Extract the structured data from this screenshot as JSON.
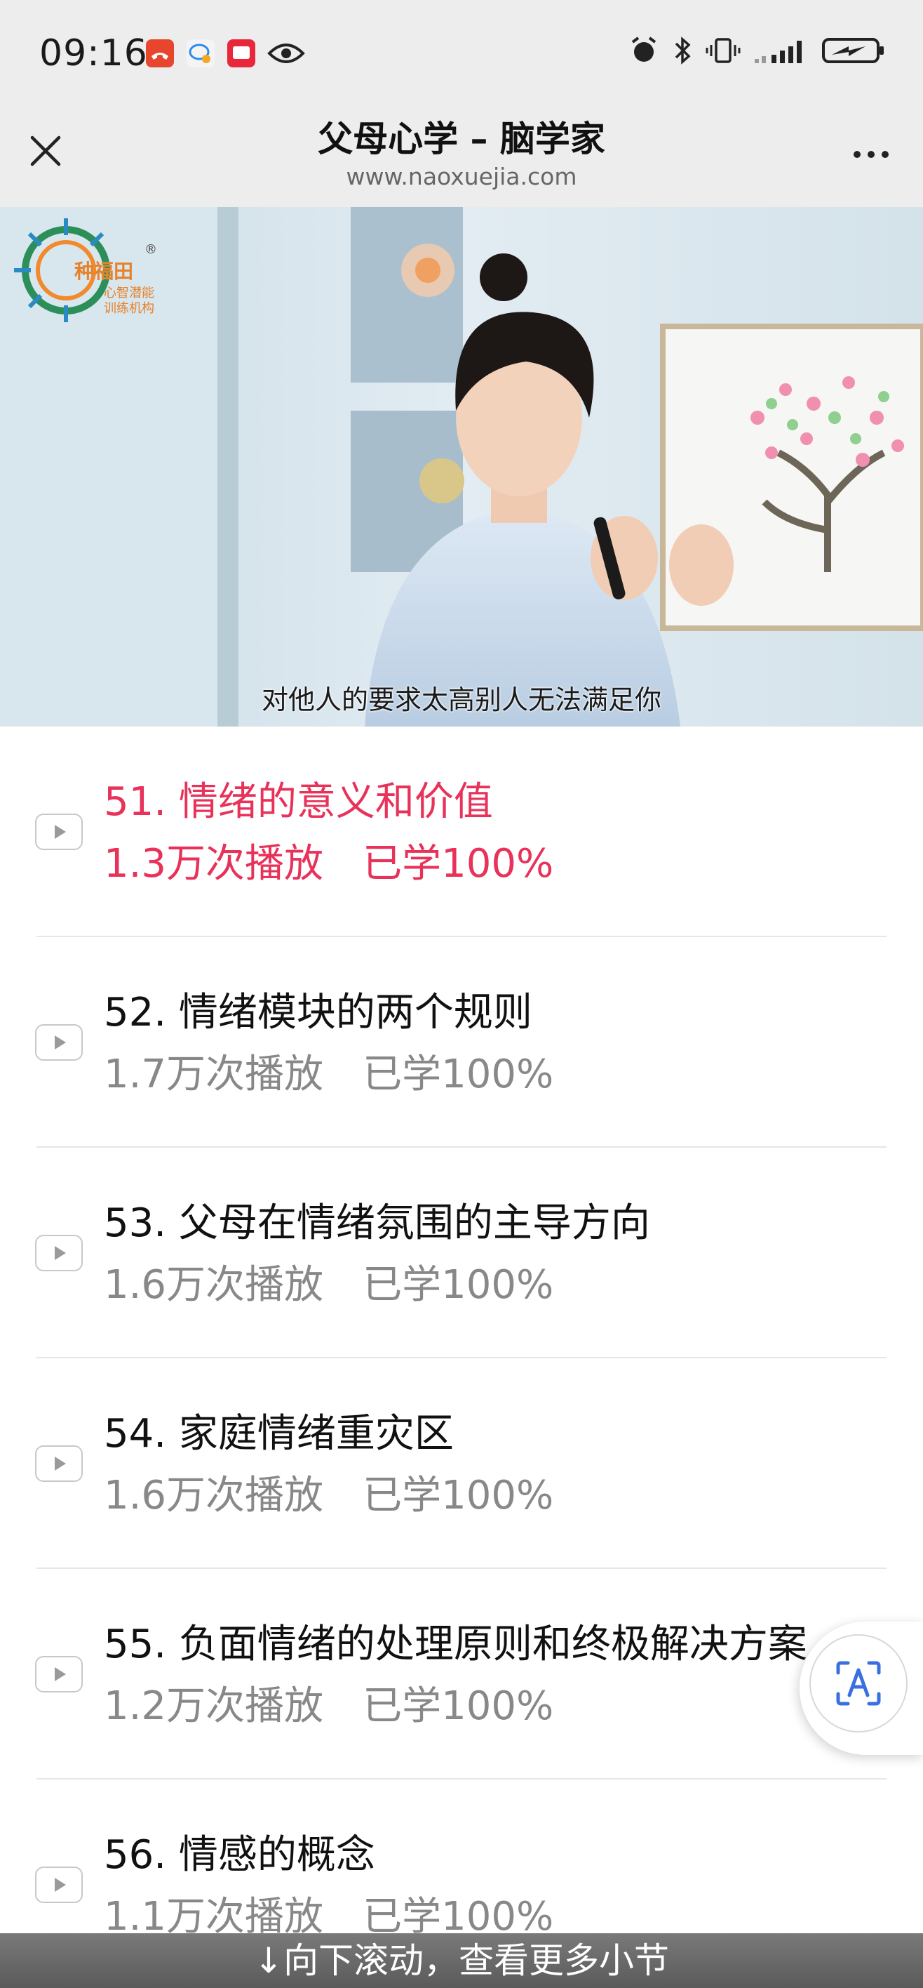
{
  "status_bar": {
    "time": "09:16",
    "left_icons": [
      "missed-call-icon",
      "chat-bubble-icon",
      "red-app-icon",
      "eye-icon"
    ],
    "right_icons": [
      "alarm-icon",
      "bluetooth-icon",
      "vibrate-icon",
      "signal-icon",
      "battery-charging-icon"
    ]
  },
  "header": {
    "title": "父母心学 – 脑学家",
    "url": "www.naoxuejia.com"
  },
  "video": {
    "subtitle": "对他人的要求太高别人无法满足你",
    "logo_text": "种福田",
    "logo_sub_1": "心智潜能",
    "logo_sub_2": "训练机构",
    "logo_mark": "®"
  },
  "lessons": [
    {
      "title": "51. 情绪的意义和价值",
      "views": "1.3万次播放",
      "progress": "已学100%",
      "active": true
    },
    {
      "title": "52. 情绪模块的两个规则",
      "views": "1.7万次播放",
      "progress": "已学100%",
      "active": false
    },
    {
      "title": "53. 父母在情绪氛围的主导方向",
      "views": "1.6万次播放",
      "progress": "已学100%",
      "active": false
    },
    {
      "title": "54. 家庭情绪重灾区",
      "views": "1.6万次播放",
      "progress": "已学100%",
      "active": false
    },
    {
      "title": "55. 负面情绪的处理原则和终极解决方案",
      "views": "1.2万次播放",
      "progress": "已学100%",
      "active": false
    },
    {
      "title": "56. 情感的概念",
      "views": "1.1万次播放",
      "progress": "已学100%",
      "active": false
    }
  ],
  "scroll_hint": "↓向下滚动，查看更多小节",
  "colors": {
    "accent": "#e8325a",
    "bar_bg": "#ededed",
    "muted": "#888888"
  }
}
